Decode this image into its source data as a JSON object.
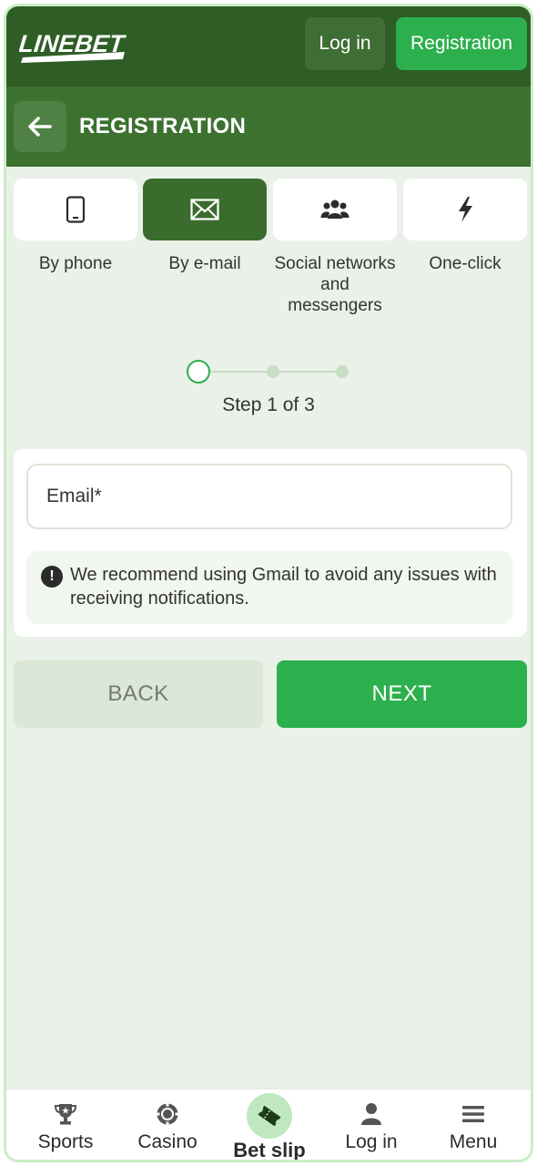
{
  "header": {
    "logo_text": "LINEBET",
    "login_label": "Log in",
    "register_label": "Registration"
  },
  "titlebar": {
    "title": "REGISTRATION"
  },
  "methods": [
    {
      "label": "By phone",
      "icon": "phone-icon",
      "active": false
    },
    {
      "label": "By e-mail",
      "icon": "envelope-icon",
      "active": true
    },
    {
      "label": "Social networks and messengers",
      "icon": "users-icon",
      "active": false
    },
    {
      "label": "One-click",
      "icon": "lightning-icon",
      "active": false
    }
  ],
  "stepper": {
    "current": 1,
    "total": 3,
    "text": "Step 1 of 3"
  },
  "form": {
    "email_placeholder": "Email*",
    "email_value": "",
    "notice": "We recommend using Gmail to avoid any issues with receiving notifications."
  },
  "actions": {
    "back_label": "BACK",
    "next_label": "NEXT"
  },
  "bottom_nav": [
    {
      "label": "Sports",
      "icon": "trophy-icon"
    },
    {
      "label": "Casino",
      "icon": "casino-chip-icon"
    },
    {
      "label": "Bet slip",
      "icon": "ticket-icon"
    },
    {
      "label": "Log in",
      "icon": "user-icon"
    },
    {
      "label": "Menu",
      "icon": "hamburger-menu-icon"
    }
  ],
  "colors": {
    "header_bg": "#2f5d26",
    "titlebar_bg": "#3c7130",
    "accent_green": "#2cb04e",
    "active_tile": "#3a6c2d",
    "page_bg": "#eaf1e8"
  }
}
